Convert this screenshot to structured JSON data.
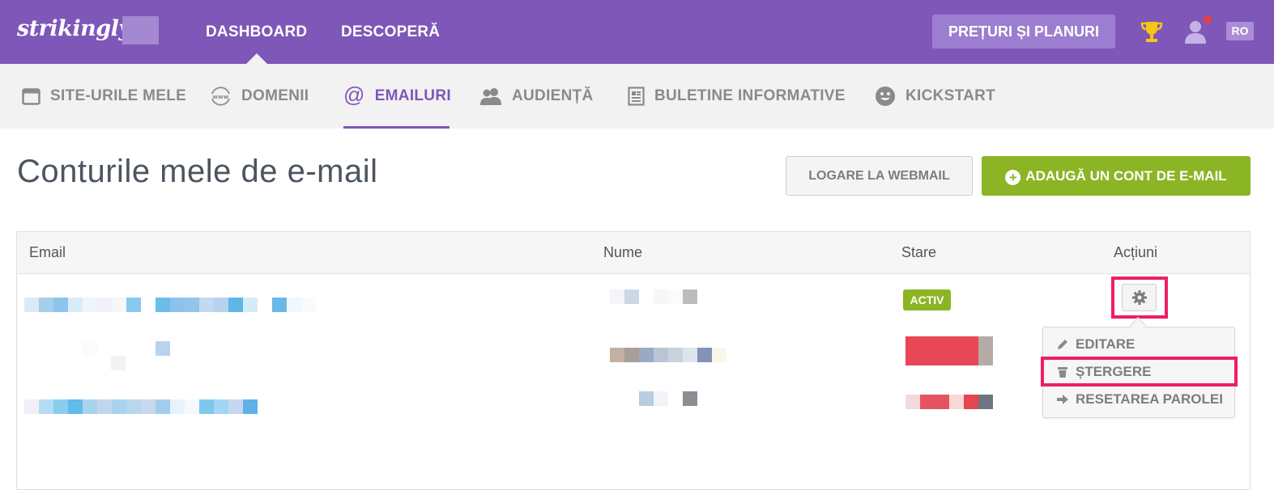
{
  "topbar": {
    "logo": "strikingly",
    "nav": [
      "DASHBOARD",
      "DESCOPERĂ"
    ],
    "pricing_label": "PREȚURI ȘI PLANURI",
    "language": "RO",
    "accent_color": "#7e57b8"
  },
  "subnav": {
    "tabs": [
      {
        "label": "SITE-URILE MELE",
        "icon": "browser-window-icon"
      },
      {
        "label": "DOMENII",
        "icon": "www-icon"
      },
      {
        "label": "EMAILURI",
        "icon": "at-sign-icon",
        "active": true
      },
      {
        "label": "AUDIENȚĂ",
        "icon": "people-icon"
      },
      {
        "label": "BULETINE INFORMATIVE",
        "icon": "newsletter-icon"
      },
      {
        "label": "KICKSTART",
        "icon": "smiley-icon"
      }
    ]
  },
  "page": {
    "title": "Conturile mele de e-mail",
    "webmail_label": "LOGARE LA WEBMAIL",
    "add_account_label": "ADAUGĂ UN CONT DE E-MAIL",
    "add_button_color": "#8bb524"
  },
  "table": {
    "headers": [
      "Email",
      "Nume",
      "Stare",
      "Acțiuni"
    ],
    "rows": [
      {
        "status": "ACTIV"
      },
      {
        "status": ""
      },
      {
        "status": ""
      }
    ]
  },
  "actions_menu": {
    "items": [
      {
        "label": "EDITARE",
        "icon": "pencil-icon"
      },
      {
        "label": "ȘTERGERE",
        "icon": "trash-icon"
      },
      {
        "label": "RESETAREA PAROLEI",
        "icon": "arrow-right-icon"
      }
    ],
    "highlight_color": "#ee1f60"
  }
}
